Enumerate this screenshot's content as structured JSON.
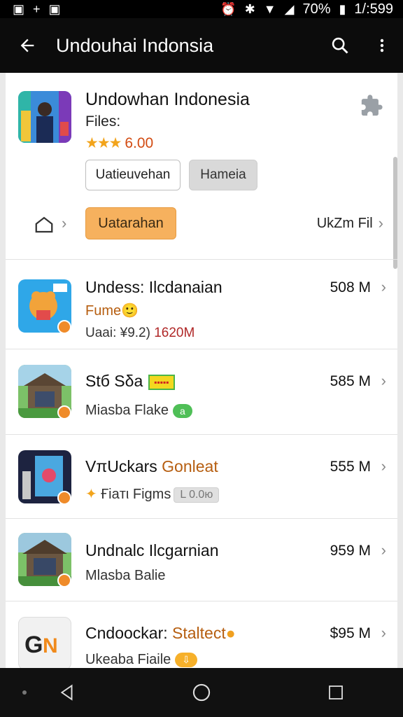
{
  "status_bar": {
    "battery_text": "70%",
    "time": "1/:599"
  },
  "toolbar": {
    "title": "Undouhai Indonsia"
  },
  "header": {
    "title": "Undowhan Indonesia",
    "subtitle": "Files:",
    "stars": "★★★",
    "rating": "6.00",
    "button_outline": "Uatieuvehan",
    "button_gray": "Hameia",
    "button_orange": "Uatarahan",
    "link": "UkZm Fil"
  },
  "items": [
    {
      "title": "Undess: Ilcdanaian",
      "accent": "",
      "subtitle": "Fume",
      "emoji": "🙂",
      "subtitle2": "Uaai: ¥9.2)",
      "subtitle2_accent": "1620M",
      "size": "508 M"
    },
    {
      "title": "Stб Sδa",
      "accent": "",
      "tag": "▪▪▪▪▪",
      "subtitle": "Miasba Flake",
      "pill": "a",
      "size": "585 M"
    },
    {
      "title": "VπUckars",
      "accent": "Gonleat",
      "subtitle": "Ғiaтι Figms",
      "pill_gray": "L 0.0ю",
      "size": "555 M"
    },
    {
      "title": "Undnalc Ilcgarnian",
      "accent": "",
      "subtitle": "Mlasba Balie",
      "size": "959 M"
    },
    {
      "title": "Cndoockar:",
      "accent": "Staltect",
      "subtitle": "Ukeaba Fiaile",
      "pill": "⇩",
      "size": "$95 M"
    }
  ],
  "colors": {
    "accent_orange": "#f6b15e",
    "toolbar_bg": "#0c0c0c",
    "rating_color": "#d24b12"
  }
}
